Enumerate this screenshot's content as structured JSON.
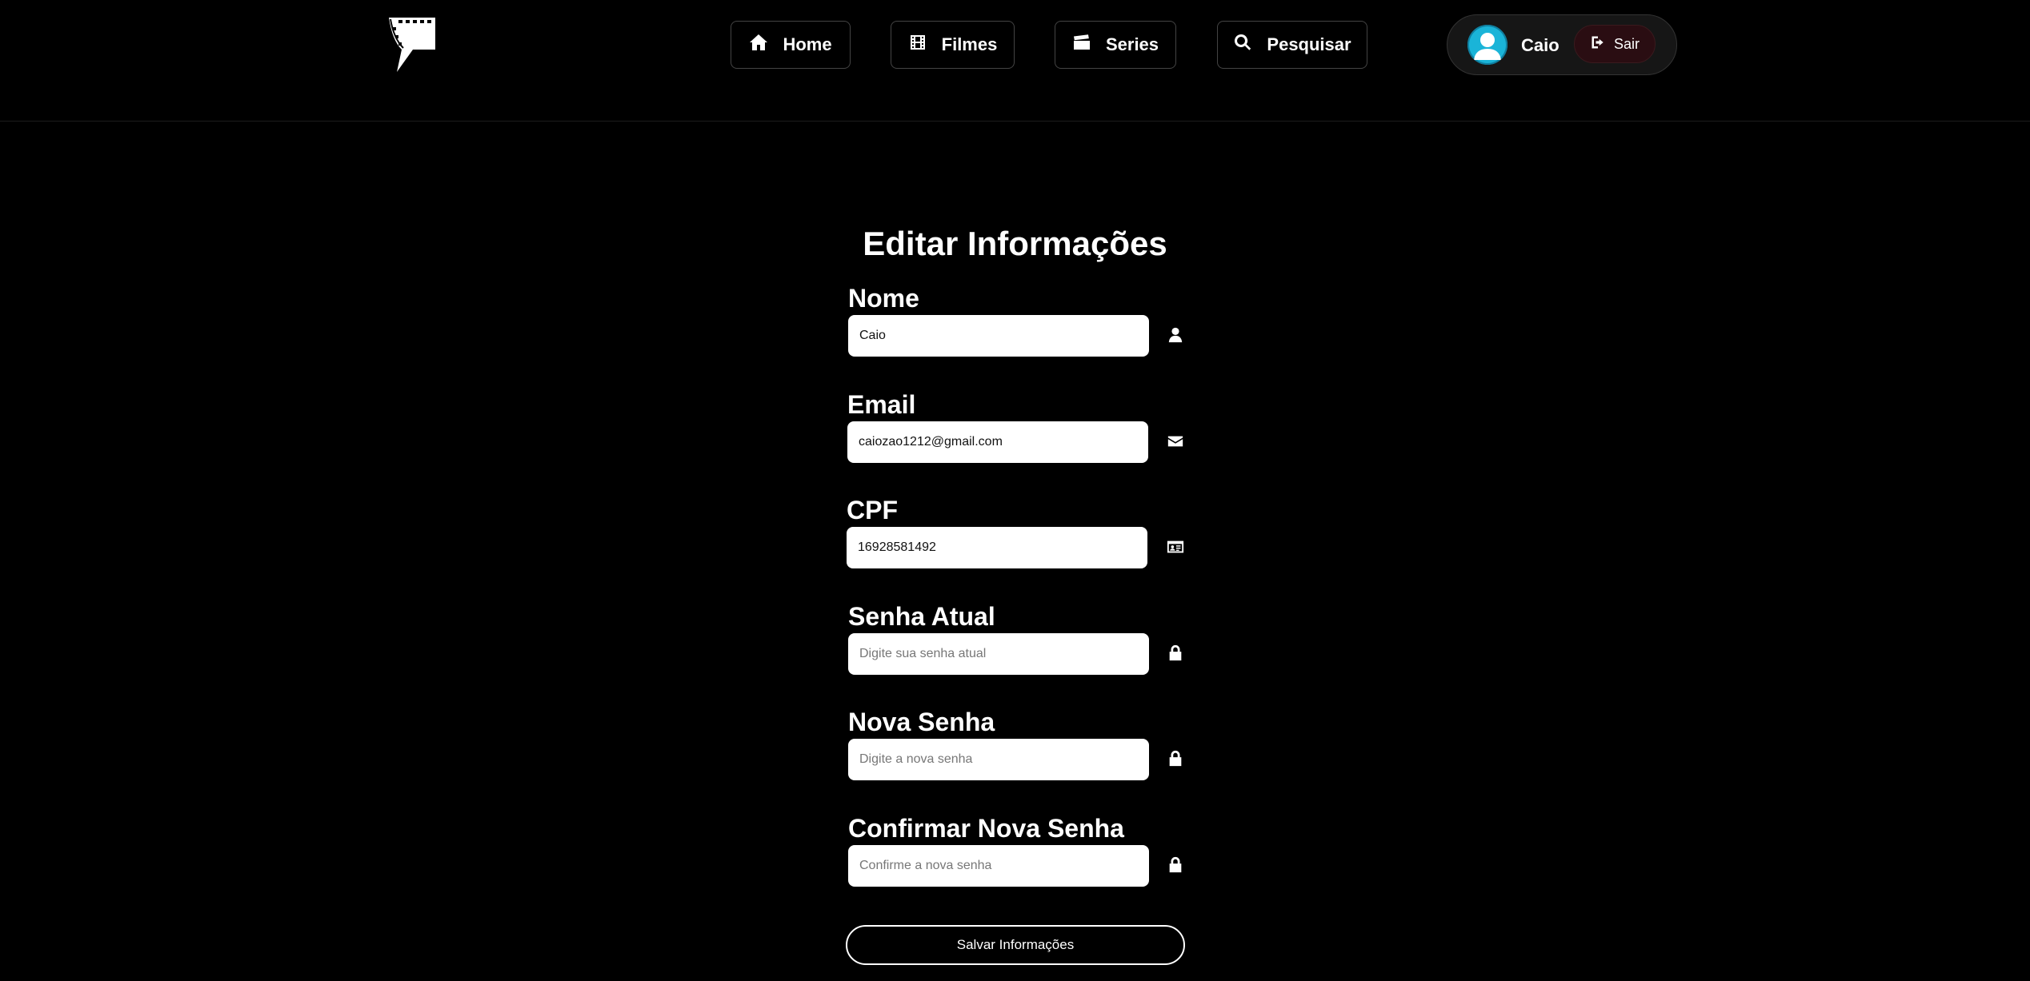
{
  "nav": {
    "home": "Home",
    "movies": "Filmes",
    "series": "Series",
    "search": "Pesquisar"
  },
  "user": {
    "name": "Caio",
    "logout_label": "Sair"
  },
  "form": {
    "title": "Editar Informações",
    "fields": {
      "name": {
        "label": "Nome",
        "value": "Caio",
        "placeholder": ""
      },
      "email": {
        "label": "Email",
        "value": "caiozao1212@gmail.com",
        "placeholder": ""
      },
      "cpf": {
        "label": "CPF",
        "value": "16928581492",
        "placeholder": ""
      },
      "current_password": {
        "label": "Senha Atual",
        "value": "",
        "placeholder": "Digite sua senha atual"
      },
      "new_password": {
        "label": "Nova Senha",
        "value": "",
        "placeholder": "Digite a nova senha"
      },
      "confirm_password": {
        "label": "Confirmar Nova Senha",
        "value": "",
        "placeholder": "Confirme a nova senha"
      }
    },
    "submit_label": "Salvar Informações"
  },
  "icons": {
    "logo": "film-clapper-logo",
    "home": "home-icon",
    "movies": "film-icon",
    "series": "clapperboard-icon",
    "search": "search-icon",
    "logout": "logout-icon",
    "name": "user-icon",
    "email": "envelope-icon",
    "cpf": "id-card-icon",
    "password": "lock-icon"
  },
  "colors": {
    "background": "#000000",
    "avatar": "#1ab4d8",
    "logout_bg": "#2a0d12"
  }
}
